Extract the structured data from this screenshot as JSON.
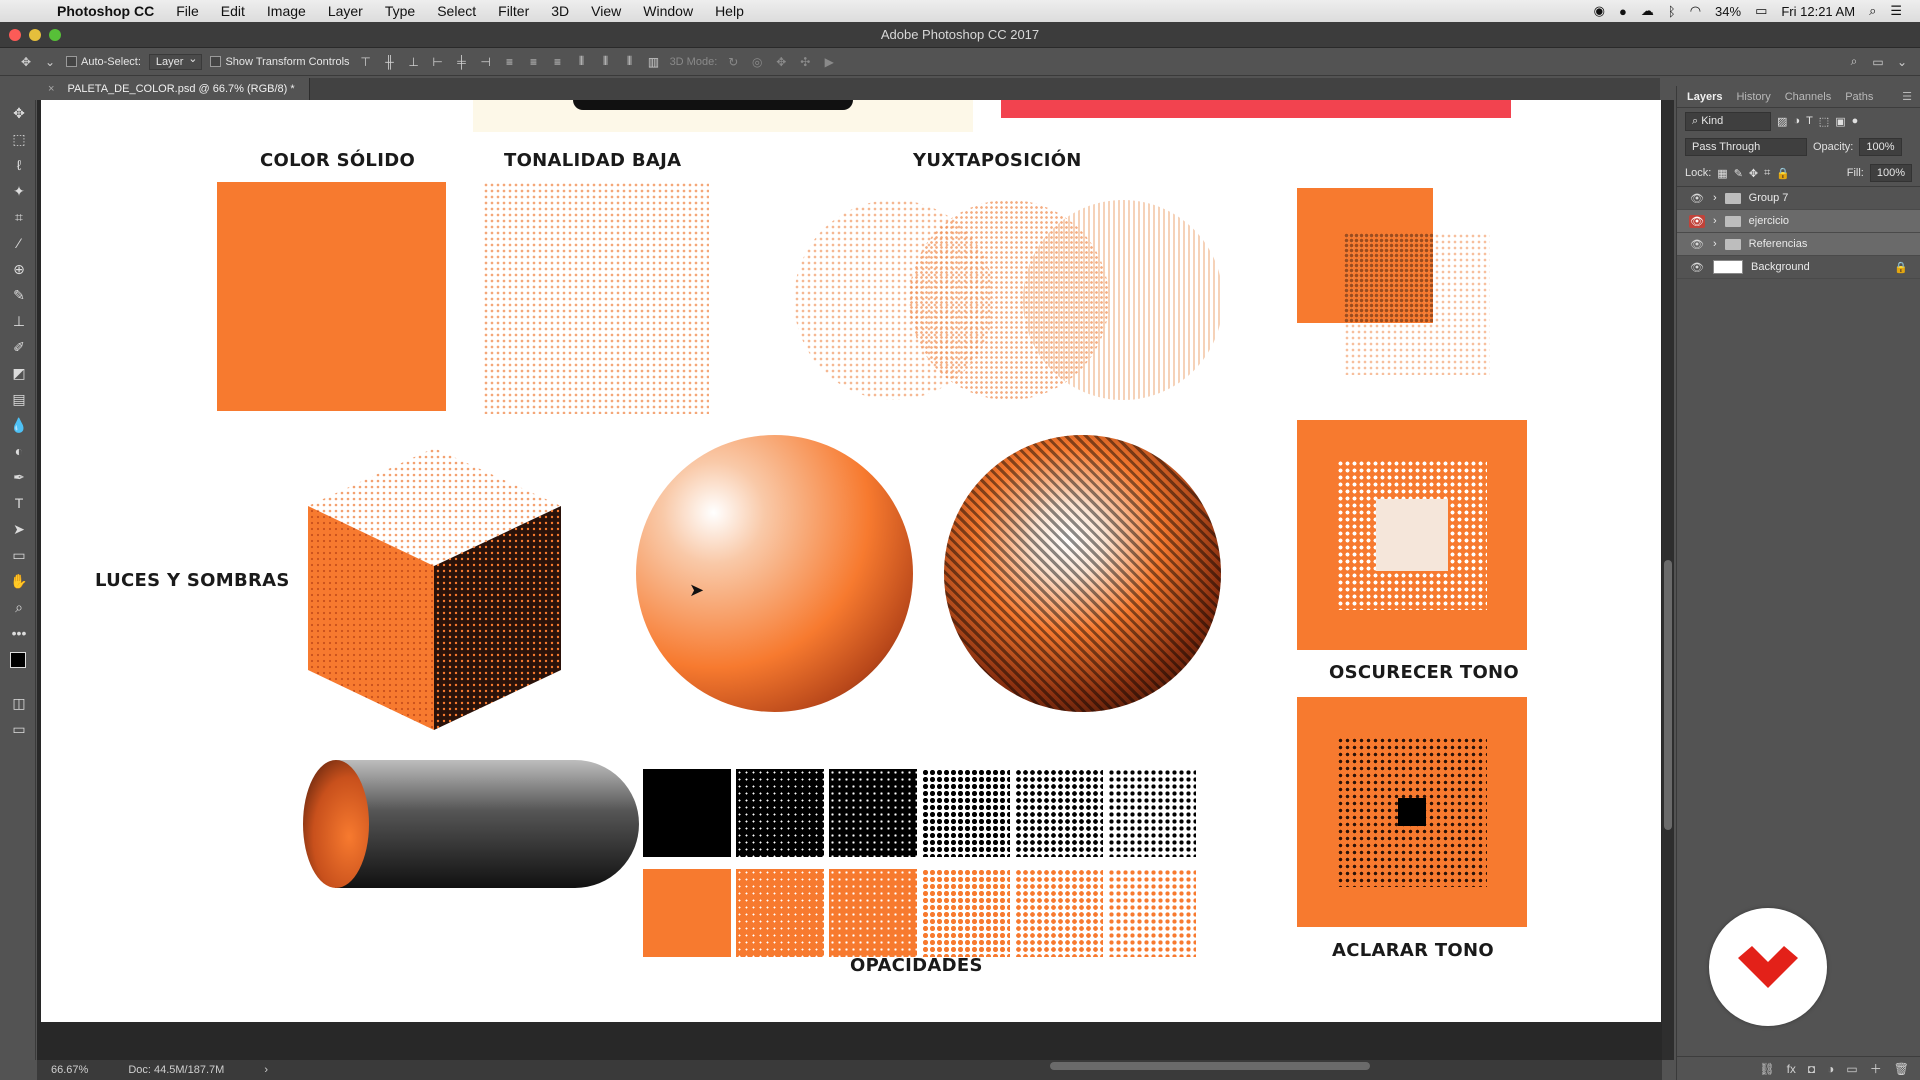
{
  "menubar": {
    "app_name": "Photoshop CC",
    "items": [
      "File",
      "Edit",
      "Image",
      "Layer",
      "Type",
      "Select",
      "Filter",
      "3D",
      "View",
      "Window",
      "Help"
    ],
    "battery": "34%",
    "clock": "Fri 12:21 AM"
  },
  "window": {
    "title": "Adobe Photoshop CC 2017"
  },
  "options": {
    "auto_select_label": "Auto-Select:",
    "auto_select_value": "Layer",
    "show_transform_label": "Show Transform Controls",
    "mode_3d_label": "3D Mode:"
  },
  "document": {
    "tab_title": "PALETA_DE_COLOR.psd @ 66.7% (RGB/8) *"
  },
  "canvas_labels": {
    "solid": "COLOR SÓLIDO",
    "low_tone": "TONALIDAD BAJA",
    "juxta": "YUXTAPOSICIÓN",
    "lights": "LUCES Y SOMBRAS",
    "darken": "OSCURECER TONO",
    "lighten": "ACLARAR TONO",
    "opacities": "OPACIDADES"
  },
  "colors": {
    "orange": "#f77a2f",
    "red_bar": "#f2434f",
    "brand_red": "#e32119"
  },
  "status": {
    "zoom": "66.67%",
    "doc": "Doc: 44.5M/187.7M"
  },
  "panel": {
    "tabs": [
      "Layers",
      "History",
      "Channels",
      "Paths"
    ],
    "kind_label": "Kind",
    "blend_mode": "Pass Through",
    "opacity_label": "Opacity:",
    "opacity_value": "100%",
    "lock_label": "Lock:",
    "fill_label": "Fill:",
    "fill_value": "100%",
    "layers": [
      {
        "name": "Group 7"
      },
      {
        "name": "ejercicio"
      },
      {
        "name": "Referencias"
      },
      {
        "name": "Background"
      }
    ]
  }
}
